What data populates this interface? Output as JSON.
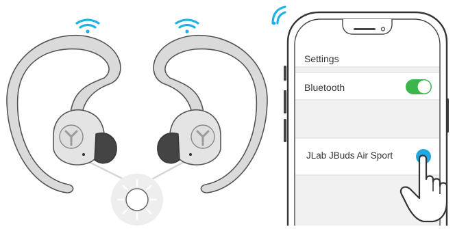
{
  "phone": {
    "settings_label": "Settings",
    "bluetooth_label": "Bluetooth",
    "device_name": "JLab JBuds Air Sport",
    "bluetooth_toggle": {
      "on": true
    }
  },
  "colors": {
    "signal": "#1fb1e6",
    "toggle_on": "#3cb54a",
    "select_dot": "#1fa8e0",
    "earbud_body": "#dcdcdc",
    "earbud_outline": "#555555",
    "list_bg": "#f1f1f1"
  },
  "icons": {
    "wifi_left": "wifi-signal-icon",
    "wifi_right": "wifi-signal-icon",
    "phone_signal": "signal-icon",
    "led": "led-light-icon",
    "tap_hand": "pointing-hand-icon",
    "logo": "jlab-logo-icon"
  }
}
